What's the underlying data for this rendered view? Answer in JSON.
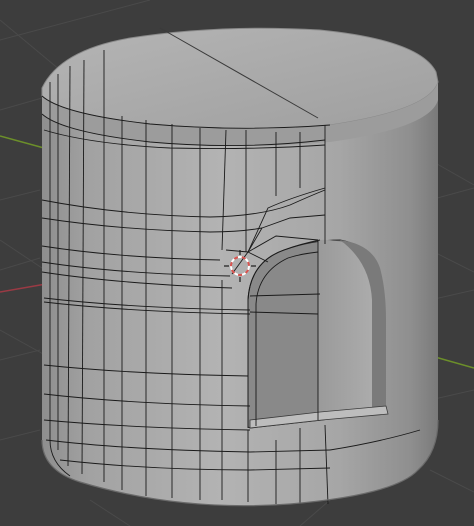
{
  "viewport": {
    "editor": "3D Viewport",
    "background_color": "#3d3d3d",
    "grid_color": "#4a4a4a",
    "x_axis_color": "#9a3a44",
    "y_axis_color": "#6c8f2a",
    "mesh_color": "#a6a6a6",
    "wire_color": "#1a1a1a"
  },
  "scene": {
    "object_type": "cylinder-mesh-with-arched-door",
    "cursor_icon": "3d-cursor-icon",
    "visible_overlays": [
      "floor-grid",
      "x-axis-line",
      "y-axis-line",
      "mesh-wireframe"
    ]
  }
}
